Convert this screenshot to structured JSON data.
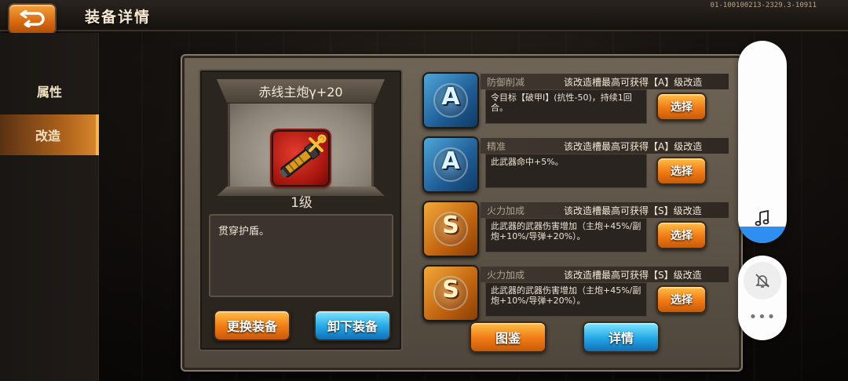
{
  "header": {
    "title": "装备详情",
    "build_id": "01-100100213-2329.3-10911",
    "back_icon": "back-arrow-icon"
  },
  "sidebar": {
    "tabs": [
      {
        "label": "属性",
        "active": false
      },
      {
        "label": "改造",
        "active": true
      }
    ]
  },
  "equipment": {
    "name": "赤线主炮γ+20",
    "level": "1级",
    "icon": "cannon-barrel-icon",
    "description": "贯穿护盾。"
  },
  "buttons": {
    "change": "更换装备",
    "unequip": "卸下装备",
    "atlas": "图鉴",
    "detail": "详情"
  },
  "mods": [
    {
      "grade": "A",
      "name": "防御削减",
      "cap": "该改造槽最高可获得【A】级改造",
      "effect": "令目标【破甲Ⅰ】(抗性-50)，持续1回合。",
      "select": "选择"
    },
    {
      "grade": "A",
      "name": "精准",
      "cap": "该改造槽最高可获得【A】级改造",
      "effect": "此武器命中+5%。",
      "select": "选择"
    },
    {
      "grade": "S",
      "name": "火力加成",
      "cap": "该改造槽最高可获得【S】级改造",
      "effect": "此武器的武器伤害增加（主炮+45%/副炮+10%/导弹+20%）。",
      "select": "选择"
    },
    {
      "grade": "S",
      "name": "火力加成",
      "cap": "该改造槽最高可获得【S】级改造",
      "effect": "此武器的武器伤害增加（主炮+45%/副炮+10%/导弹+20%）。",
      "select": "选择"
    }
  ],
  "overlay": {
    "music_icon": "music-note-icon",
    "music_level": 0.08,
    "mute_icon": "bell-off-icon",
    "more_label": "•••",
    "accent": "#2f8ff0"
  }
}
